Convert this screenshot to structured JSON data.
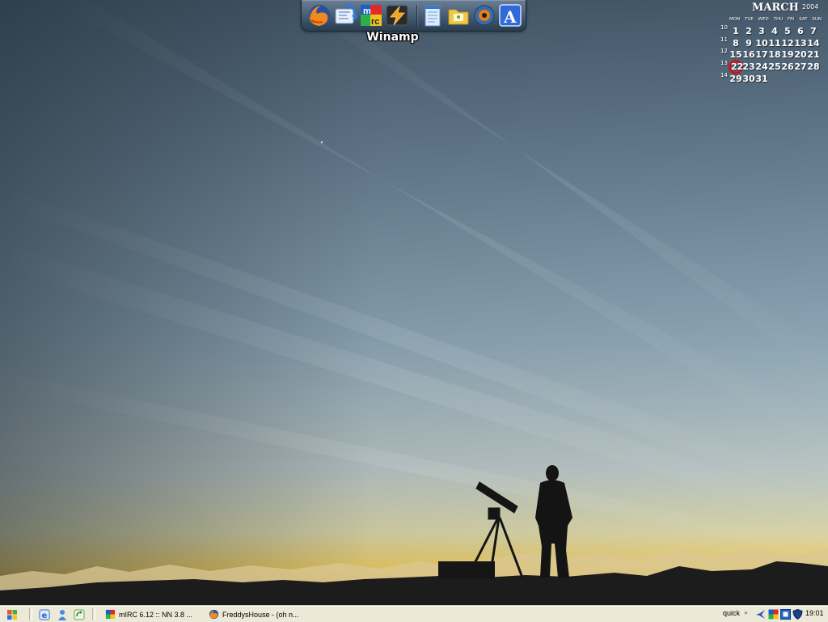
{
  "dock": {
    "label": "Winamp",
    "icons": [
      "firefox-icon",
      "sync-icon",
      "mirc-icon",
      "winamp-icon",
      "notepad-icon",
      "folder-icon",
      "media-player-icon",
      "text-editor-icon"
    ]
  },
  "calendar": {
    "month": "MARCH",
    "year": "2004",
    "weekdays": [
      "MON",
      "TUE",
      "WED",
      "THU",
      "FRI",
      "SAT",
      "SUN"
    ],
    "today": "22",
    "weeks": [
      {
        "number": "10",
        "days": [
          "",
          "",
          "",
          "",
          "",
          "",
          "",
          "1",
          "2",
          "3",
          "4",
          "5",
          "6",
          "7"
        ]
      },
      {
        "number": "11",
        "days": [
          "8",
          "9",
          "10",
          "11",
          "12",
          "13",
          "14"
        ]
      },
      {
        "number": "12",
        "days": [
          "15",
          "16",
          "17",
          "18",
          "19",
          "20",
          "21"
        ]
      },
      {
        "number": "13",
        "days": [
          "22",
          "23",
          "24",
          "25",
          "26",
          "27",
          "28"
        ]
      },
      {
        "number": "14",
        "days": [
          "29",
          "30",
          "31"
        ]
      }
    ]
  },
  "taskbar": {
    "tasks": [
      {
        "label": "mIRC 6.12 :: NN 3.8 ...",
        "icon": "mirc-icon"
      },
      {
        "label": "FreddysHouse - (oh n...",
        "icon": "firefox-icon"
      }
    ],
    "tray": {
      "quick_label": "quick",
      "chevron": "»",
      "clock": "19:01",
      "icons": [
        "network-icon",
        "mirc-tray-icon",
        "app-tray-icon",
        "shield-icon"
      ]
    }
  },
  "colors": {
    "sky_top": "#3e4f5e",
    "sky_mid": "#8aa2b3",
    "horizon": "#e8c560",
    "ground": "#1b1b1b",
    "today_circle": "#d4101a",
    "taskbar": "#ece9d8"
  }
}
